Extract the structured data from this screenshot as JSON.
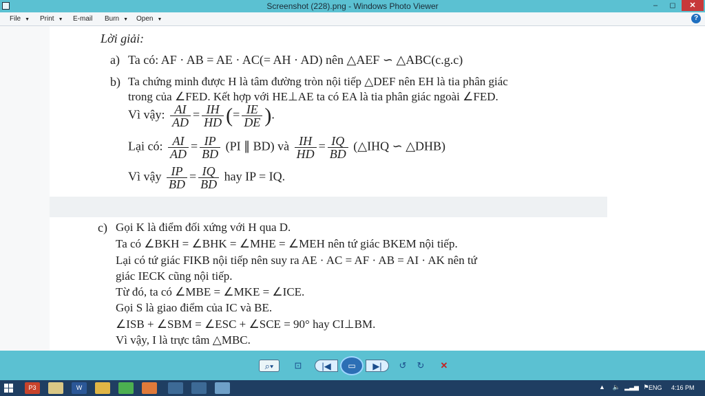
{
  "window": {
    "title": "Screenshot (228).png - Windows Photo Viewer",
    "min": "–",
    "max": "◻",
    "close": "✕"
  },
  "menu": {
    "file": "File",
    "print": "Print",
    "email": "E-mail",
    "burn": "Burn",
    "open": "Open",
    "help": "?"
  },
  "doc": {
    "heading": "Lời giải:",
    "a_label": "a)",
    "a_text": "Ta có: AF · AB = AE · AC(= AH · AD) nên △AEF ∽ △ABC(c.g.c)",
    "b_label": "b)",
    "b_line1": "Ta chứng minh được H là tâm đường tròn nội tiếp △DEF nên EH là tia phân giác",
    "b_line2": "trong của ∠FED. Kết hợp với HE⊥AE ta có EA là tia phân giác ngoài ∠FED.",
    "b3_prefix": "Vì vậy:",
    "b3_f1_num": "AI",
    "b3_f1_den": "AD",
    "b3_f2_num": "IH",
    "b3_f2_den": "HD",
    "b3_f3_num": "IE",
    "b3_f3_den": "DE",
    "b4_prefix": "Lại có:",
    "b4_f1_num": "AI",
    "b4_f1_den": "AD",
    "b4_f2_num": "IP",
    "b4_f2_den": "BD",
    "b4_mid": "(PI ∥ BD) và",
    "b4_f3_num": "IH",
    "b4_f3_den": "HD",
    "b4_f4_num": "IQ",
    "b4_f4_den": "BD",
    "b4_tail": "(△IHQ ∽ △DHB)",
    "b5_prefix": "Vì vậy",
    "b5_f1_num": "IP",
    "b5_f1_den": "BD",
    "b5_f2_num": "IQ",
    "b5_f2_den": "BD",
    "b5_tail": "hay IP = IQ.",
    "c_label": "c)",
    "c_line1": "Gọi K là điểm đối xứng với H qua D.",
    "c_line2": "Ta có ∠BKH = ∠BHK = ∠MHE = ∠MEH nên tứ giác BKEM nội tiếp.",
    "c_line3": "Lại có tứ giác FIKB nội tiếp nên suy ra AE · AC = AF · AB = AI · AK nên tứ",
    "c_line4": "giác IECK cũng nội tiếp.",
    "c_line5": "Từ đó, ta có ∠MBE = ∠MKE = ∠ICE.",
    "c_line6": "Gọi S là giao điểm của IC và BE.",
    "c_line7": "∠ISB + ∠SBM = ∠ESC + ∠SCE = 90° hay CI⊥BM.",
    "c_line8": "Vì vậy, I là trực tâm △MBC."
  },
  "controls": {
    "zoom": "⌕▾",
    "fit": "⊡",
    "prev": "|◀",
    "slideshow": "▭",
    "next": "▶|",
    "rotl": "↺",
    "rotr": "↻",
    "delete": "✕"
  },
  "taskbar": {
    "app_p3": "P3",
    "app_w": "W",
    "tray_up": "▲",
    "lang": "ENG",
    "time": "4:16 PM"
  },
  "colors": {
    "titlebar": "#5bc1d2",
    "taskbar": "#1f3e62",
    "close": "#c7383a"
  }
}
